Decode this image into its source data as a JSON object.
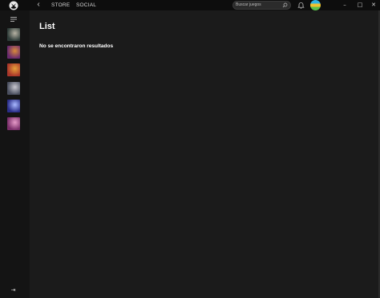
{
  "header": {
    "nav": [
      "STORE",
      "SOCIAL"
    ],
    "search": {
      "placeholder": "Buscar juegos"
    }
  },
  "sidebar": {
    "games": [
      {
        "icon": "game-art-1",
        "colors": [
          "#2f3d3a",
          "#b6b2a3"
        ]
      },
      {
        "icon": "game-art-2",
        "colors": [
          "#6a2a6e",
          "#d88a3a"
        ]
      },
      {
        "icon": "game-art-3",
        "colors": [
          "#a8352a",
          "#e6a03a"
        ]
      },
      {
        "icon": "game-art-4",
        "colors": [
          "#4a4f5f",
          "#c8c8d0"
        ]
      },
      {
        "icon": "game-art-5",
        "colors": [
          "#2a2e8a",
          "#a8b8ff"
        ]
      },
      {
        "icon": "game-art-6",
        "colors": [
          "#7a2e6a",
          "#e69ac8"
        ]
      }
    ]
  },
  "main": {
    "title": "List",
    "empty_message": "No se encontraron resultados"
  },
  "colors": {
    "background": "#1b1b1b",
    "sidebar": "#141414",
    "titlebar": "#0d0d0d",
    "text": "#ffffff"
  }
}
